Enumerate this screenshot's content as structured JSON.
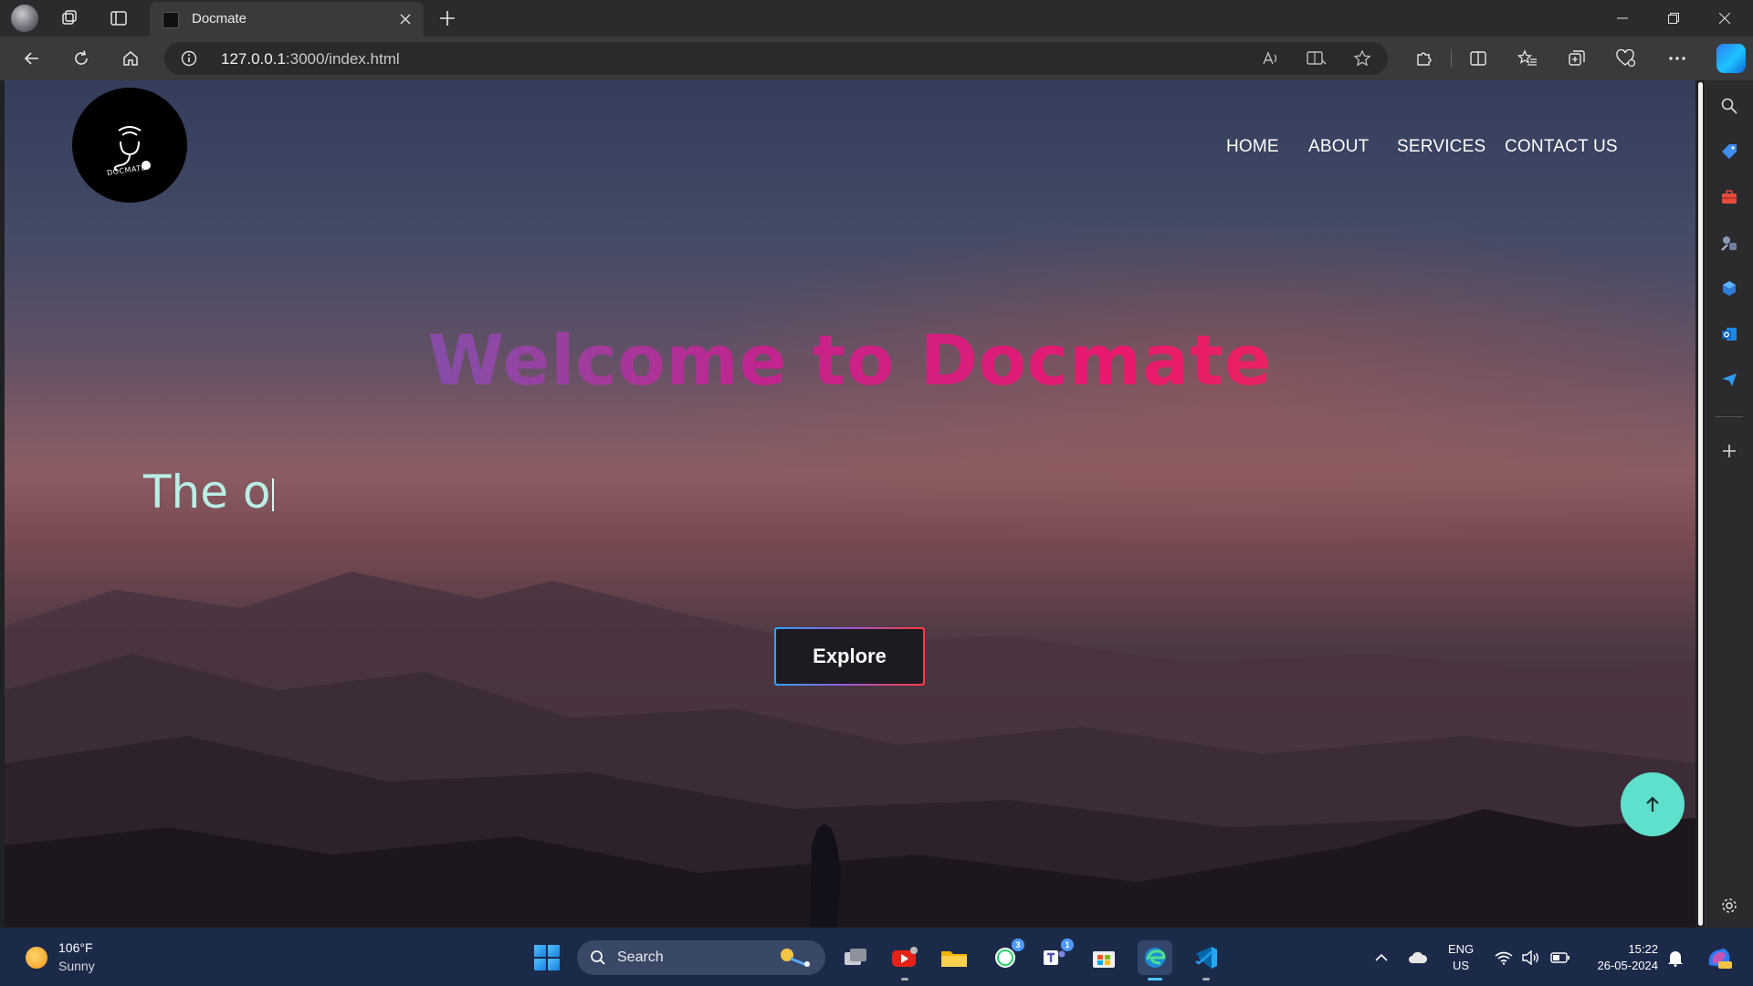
{
  "browser": {
    "tab_title": "Docmate",
    "url_host": "127.0.0.1",
    "url_rest": ":3000/index.html"
  },
  "page": {
    "logo_text": "DOCMATE",
    "nav": [
      "HOME",
      "ABOUT",
      "SERVICES",
      "CONTACT US"
    ],
    "hero_title": "Welcome to Docmate",
    "typed_text": "The o",
    "explore_label": "Explore"
  },
  "taskbar": {
    "weather_temp": "106°F",
    "weather_desc": "Sunny",
    "search_label": "Search",
    "whatsapp_badge": "3",
    "teams_badge": "1",
    "lang_line1": "ENG",
    "lang_line2": "US",
    "time": "15:22",
    "date": "26-05-2024"
  },
  "colors": {
    "accent_teal": "#5fe0cc",
    "title_gradient_start": "#6b5bb6",
    "title_gradient_end": "#ee3644"
  }
}
